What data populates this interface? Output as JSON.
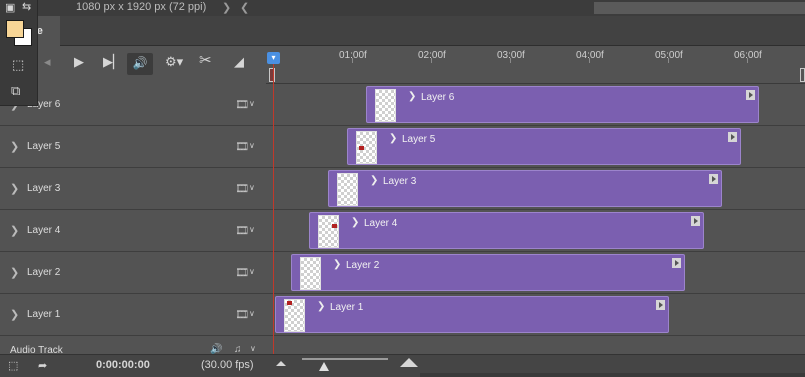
{
  "document": {
    "info": "1080 px x 1920 px (72 ppi)",
    "nav_right_icon": "chevron-right-icon",
    "nav_left_icon": "chevron-left-icon"
  },
  "panel_tab": {
    "label": "ne"
  },
  "tools": {
    "foreground_color": "#f7d596",
    "background_color": "#ffffff"
  },
  "controls": {
    "items": [
      "first-frame-icon",
      "play-icon",
      "next-frame-icon",
      "audio-icon",
      "settings-icon",
      "split-icon",
      "transition-icon"
    ]
  },
  "ruler": {
    "ticks": [
      "01:00f",
      "02:00f",
      "03:00f",
      "04:00f",
      "05:00f",
      "06:00f"
    ]
  },
  "layers": [
    {
      "name": "Layer 6"
    },
    {
      "name": "Layer 5"
    },
    {
      "name": "Layer 3"
    },
    {
      "name": "Layer 4"
    },
    {
      "name": "Layer 2"
    },
    {
      "name": "Layer 1"
    }
  ],
  "clips": [
    {
      "label": "Layer 6"
    },
    {
      "label": "Layer 5"
    },
    {
      "label": "Layer 3"
    },
    {
      "label": "Layer 4"
    },
    {
      "label": "Layer 2"
    },
    {
      "label": "Layer 1"
    }
  ],
  "audio_track": {
    "label": "Audio Track"
  },
  "status": {
    "timecode": "0:00:00:00",
    "fps": "(30.00 fps)"
  },
  "colors": {
    "clip": "#7b5fb0",
    "playhead": "#4a90e2",
    "playline": "#c0392b"
  }
}
